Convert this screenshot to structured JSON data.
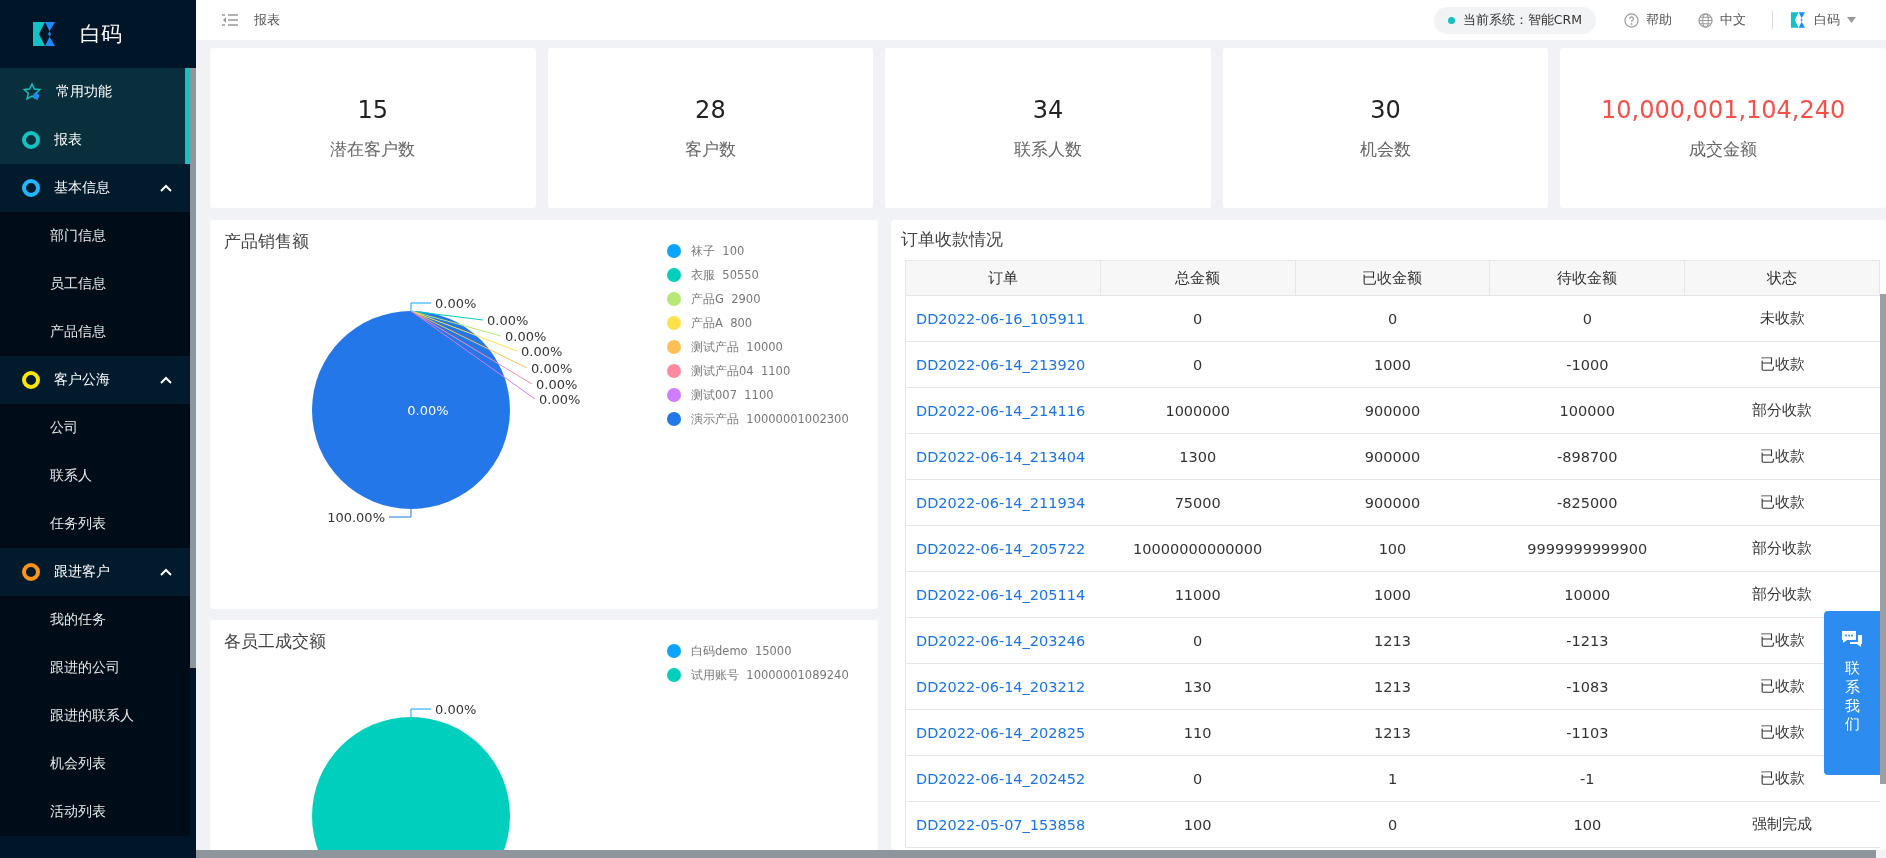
{
  "sidebar": {
    "brand": "白码",
    "items": [
      {
        "label": "常用功能",
        "kind": "star",
        "selected": true
      },
      {
        "label": "报表",
        "kind": "ring",
        "color": "#13c2c2",
        "selected": true
      },
      {
        "label": "基本信息",
        "kind": "group",
        "color": "#1fb8ff",
        "expanded": true,
        "children": [
          {
            "label": "部门信息",
            "selected": false
          },
          {
            "label": "员工信息",
            "selected": false
          },
          {
            "label": "产品信息",
            "selected": false
          }
        ]
      },
      {
        "label": "客户公海",
        "kind": "group",
        "color": "#ffe600",
        "expanded": true,
        "children": [
          {
            "label": "公司",
            "selected": false
          },
          {
            "label": "联系人",
            "selected": false
          },
          {
            "label": "任务列表",
            "selected": false
          }
        ]
      },
      {
        "label": "跟进客户",
        "kind": "group",
        "color": "#ff9419",
        "expanded": true,
        "children": [
          {
            "label": "我的任务",
            "selected": false
          },
          {
            "label": "跟进的公司",
            "selected": false
          },
          {
            "label": "跟进的联系人",
            "selected": false
          },
          {
            "label": "机会列表",
            "selected": false
          },
          {
            "label": "活动列表",
            "selected": false
          }
        ]
      }
    ]
  },
  "topbar": {
    "breadcrumb": "报表",
    "system": "当前系统：智能CRM",
    "help": "帮助",
    "language": "中文",
    "user": "白码"
  },
  "stats": [
    {
      "value": "15",
      "label": "潜在客户数",
      "highlight": false
    },
    {
      "value": "28",
      "label": "客户数",
      "highlight": false
    },
    {
      "value": "34",
      "label": "联系人数",
      "highlight": false
    },
    {
      "value": "30",
      "label": "机会数",
      "highlight": false
    },
    {
      "value": "10,000,001,104,240",
      "label": "成交金额",
      "highlight": true
    }
  ],
  "product_sales": {
    "title": "产品销售额",
    "chart_data": {
      "type": "pie",
      "categories": [
        "袜子",
        "衣服",
        "产品G",
        "产品A",
        "测试产品",
        "测试产品04",
        "测试007",
        "演示产品"
      ],
      "values": [
        0,
        0,
        0,
        0,
        0,
        0,
        0,
        100
      ],
      "colors": [
        "#0aa5ff",
        "#00cfbd",
        "#b9e876",
        "#ffe04d",
        "#ffbf55",
        "#ff8aa0",
        "#cf7cff",
        "#2377e8"
      ],
      "value_labels": [
        "0.00%",
        "0.00%",
        "0.00%",
        "0.00%",
        "0.00%",
        "0.00%",
        "0.00%",
        "100.00%"
      ],
      "annotations": [
        "0.00%"
      ]
    },
    "legend_values": [
      "100",
      "50550",
      "2900",
      "800",
      "10000",
      "1100",
      "1100",
      "10000001002300"
    ]
  },
  "staff_sales": {
    "title": "各员工成交额",
    "chart_data": {
      "type": "pie",
      "categories": [
        "白码demo",
        "试用账号"
      ],
      "values": [
        0,
        100
      ],
      "colors": [
        "#0aa5ff",
        "#00cfbd"
      ],
      "value_labels": [
        "0.00%",
        null
      ]
    },
    "legend_values": [
      "15000",
      "10000001089240"
    ]
  },
  "orders": {
    "title": "订单收款情况",
    "columns": [
      "订单",
      "总金额",
      "已收金额",
      "待收金额",
      "状态"
    ],
    "rows": [
      [
        "DD2022-06-16_105911",
        "0",
        "0",
        "0",
        "未收款"
      ],
      [
        "DD2022-06-14_213920",
        "0",
        "1000",
        "-1000",
        "已收款"
      ],
      [
        "DD2022-06-14_214116",
        "1000000",
        "900000",
        "100000",
        "部分收款"
      ],
      [
        "DD2022-06-14_213404",
        "1300",
        "900000",
        "-898700",
        "已收款"
      ],
      [
        "DD2022-06-14_211934",
        "75000",
        "900000",
        "-825000",
        "已收款"
      ],
      [
        "DD2022-06-14_205722",
        "10000000000000",
        "100",
        "9999999999900",
        "部分收款"
      ],
      [
        "DD2022-06-14_205114",
        "11000",
        "1000",
        "10000",
        "部分收款"
      ],
      [
        "DD2022-06-14_203246",
        "0",
        "1213",
        "-1213",
        "已收款"
      ],
      [
        "DD2022-06-14_203212",
        "130",
        "1213",
        "-1083",
        "已收款"
      ],
      [
        "DD2022-06-14_202825",
        "110",
        "1213",
        "-1103",
        "已收款"
      ],
      [
        "DD2022-06-14_202452",
        "0",
        "1",
        "-1",
        "已收款"
      ],
      [
        "DD2022-05-07_153858",
        "100",
        "0",
        "100",
        "强制完成"
      ]
    ]
  },
  "contact_button": "联系我们"
}
